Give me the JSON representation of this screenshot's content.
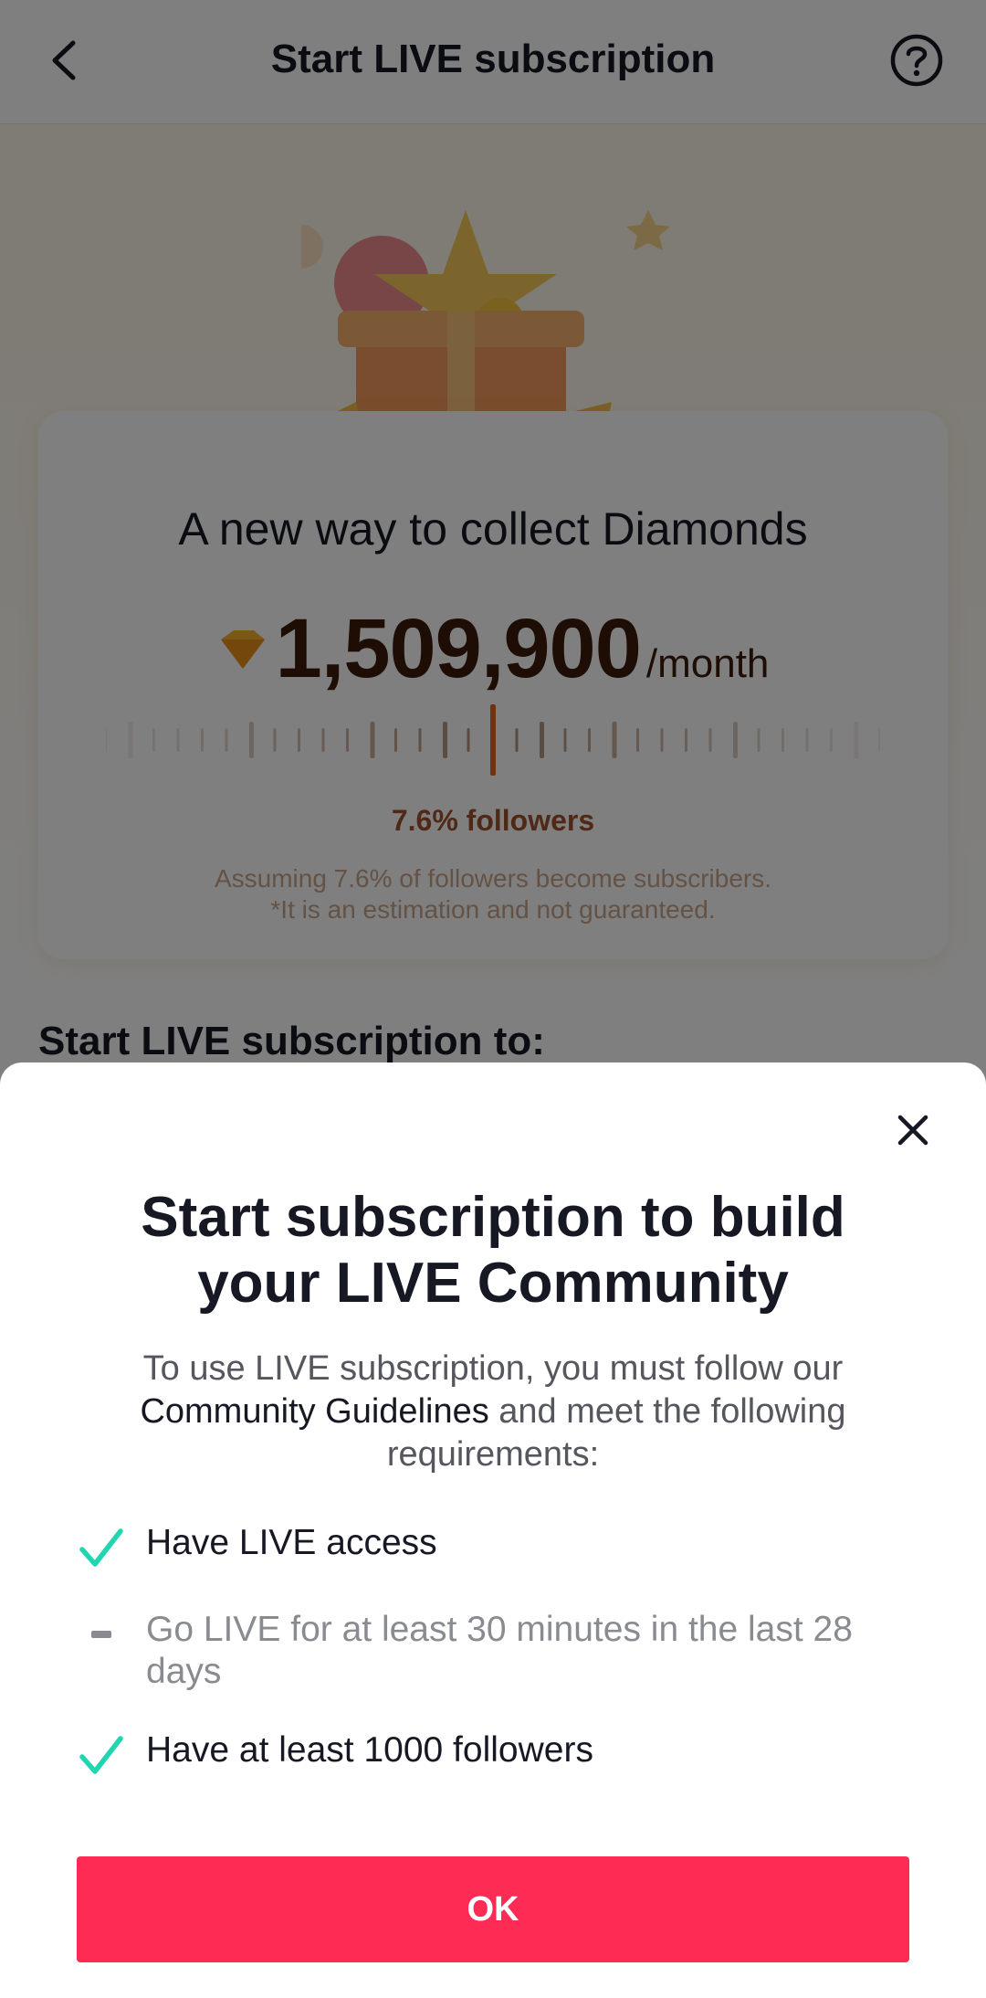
{
  "nav": {
    "title": "Start LIVE subscription"
  },
  "estimate_card": {
    "title": "A new way to collect Diamonds",
    "diamond_value": "1,509,900",
    "diamond_unit": "/month",
    "percent_label": "7.6% followers",
    "assumption_line1": "Assuming 7.6% of followers become subscribers.",
    "assumption_line2": "*It is an estimation and not guaranteed."
  },
  "section_title": "Start LIVE subscription to:",
  "sheet": {
    "title": "Start subscription to build your LIVE Community",
    "desc_before": "To use LIVE subscription, you must follow our ",
    "desc_link": "Community Guidelines",
    "desc_after": " and meet the following requirements:",
    "requirements": [
      {
        "label": "Have LIVE access",
        "status": "met"
      },
      {
        "label": "Go LIVE for at least 30 minutes in the last 28 days",
        "status": "not-met"
      },
      {
        "label": "Have at least 1000 followers",
        "status": "met"
      }
    ],
    "ok_label": "OK"
  },
  "colors": {
    "accent": "#fe2c55",
    "check": "#20d5b0",
    "text": "#161823",
    "muted": "#8a8b91"
  }
}
